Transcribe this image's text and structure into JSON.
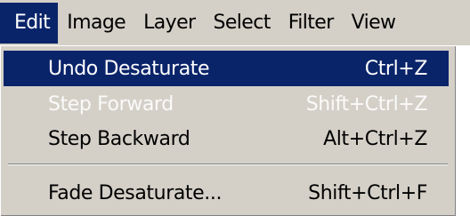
{
  "menubar": {
    "items": [
      {
        "label": "Edit"
      },
      {
        "label": "Image"
      },
      {
        "label": "Layer"
      },
      {
        "label": "Select"
      },
      {
        "label": "Filter"
      },
      {
        "label": "View"
      }
    ]
  },
  "edit_menu": {
    "items": [
      {
        "label": "Undo Desaturate",
        "shortcut": "Ctrl+Z",
        "state": "highlighted"
      },
      {
        "label": "Step Forward",
        "shortcut": "Shift+Ctrl+Z",
        "state": "disabled"
      },
      {
        "label": "Step Backward",
        "shortcut": "Alt+Ctrl+Z",
        "state": "enabled"
      },
      {
        "label": "Fade Desaturate...",
        "shortcut": "Shift+Ctrl+F",
        "state": "enabled"
      }
    ]
  },
  "colors": {
    "menu_background": "#d4d0c8",
    "highlight": "#0a246a",
    "highlight_text": "#ffffff",
    "disabled_text": "#ffffff"
  }
}
